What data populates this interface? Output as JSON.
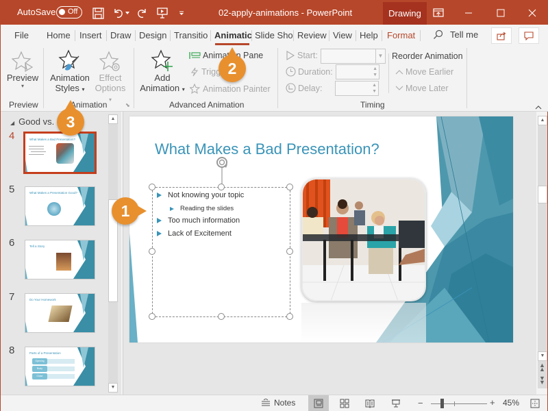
{
  "titlebar": {
    "autosave_label": "AutoSave",
    "autosave_state": "Off",
    "document_title": "02-apply-animations  -  PowerPoint",
    "context_tab": "Drawing",
    "icons": [
      "save-icon",
      "undo-icon",
      "redo-icon",
      "present-icon",
      "customize-qat-icon",
      "ribbon-display-icon",
      "minimize-icon",
      "maximize-icon",
      "close-icon"
    ]
  },
  "tabs": {
    "items": [
      "File",
      "Home",
      "Insert",
      "Draw",
      "Design",
      "Transitio",
      "Animatic",
      "Slide Sho",
      "Review",
      "View",
      "Help",
      "Format"
    ],
    "active": "Animatic",
    "tell_me": "Tell me"
  },
  "ribbon": {
    "preview": {
      "button": "Preview",
      "group": "Preview"
    },
    "animation": {
      "styles_line1": "Animation",
      "styles_line2": "Styles",
      "effect_line1": "Effect",
      "effect_line2": "Options",
      "group": "Animation"
    },
    "advanced": {
      "add_line1": "Add",
      "add_line2": "Animation",
      "pane": "Animation Pane",
      "trigger": "Trigger",
      "painter": "Animation Painter",
      "group": "Advanced Animation"
    },
    "timing": {
      "start_label": "Start:",
      "start_value": "",
      "duration_label": "Duration:",
      "duration_value": "",
      "delay_label": "Delay:",
      "delay_value": "",
      "reorder_title": "Reorder Animation",
      "move_earlier": "Move Earlier",
      "move_later": "Move Later",
      "group": "Timing"
    }
  },
  "slide_panel": {
    "section": "Good vs. Bad",
    "slides": [
      {
        "number": "4",
        "title": "What Makes a Bad Presentation?",
        "active": true
      },
      {
        "number": "5",
        "title": "What Makes a Presentation Good?",
        "active": false
      },
      {
        "number": "6",
        "title": "Tell a Story",
        "active": false
      },
      {
        "number": "7",
        "title": "Do Your Homework",
        "active": false
      },
      {
        "number": "8",
        "title": "Parts of a Presentation",
        "active": false
      }
    ],
    "slide8_boxes": [
      "Opening",
      "Body",
      "Close"
    ]
  },
  "slide": {
    "title": "What Makes a Bad Presentation?",
    "bullets": [
      {
        "text": "Not knowing your topic",
        "level": 1
      },
      {
        "text": "Reading the slides",
        "level": 2
      },
      {
        "text": "Too much information",
        "level": 1
      },
      {
        "text": "Lack of Excitement",
        "level": 1
      }
    ],
    "accent_color": "#3a94b8"
  },
  "callouts": [
    "1",
    "2",
    "3"
  ],
  "statusbar": {
    "notes": "Notes",
    "zoom_percent": "45%",
    "zoom_value": 45
  },
  "colors": {
    "brand": "#b7472a",
    "callout": "#e8902e",
    "slide_accent": "#3a94b8"
  }
}
